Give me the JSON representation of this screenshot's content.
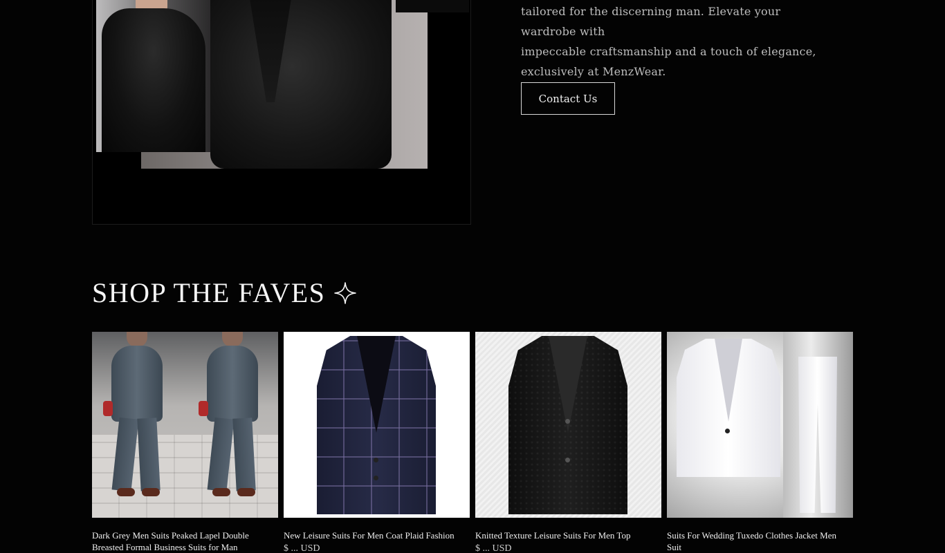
{
  "hero": {
    "paragraph_lines": [
      "tailored for the discerning man. Elevate your wardrobe with",
      "impeccable craftsmanship and a touch of elegance,",
      "exclusively at MenzWear."
    ],
    "contact_label": "Contact Us"
  },
  "section": {
    "title": "SHOP THE FAVES",
    "title_icon": "sparkle-icon"
  },
  "products": [
    {
      "title": "Dark Grey Men Suits Peaked Lapel Double Breasted Formal Business Suits for Man",
      "image": "grey-double-breasted-suit"
    },
    {
      "title": "New Leisure Suits For Men Coat Plaid Fashion",
      "price": "$ ... USD",
      "image": "navy-plaid-blazer"
    },
    {
      "title": "Knitted Texture Leisure Suits For Men Top",
      "price": "$ ... USD",
      "image": "black-knitted-blazer"
    },
    {
      "title": "Suits For Wedding Tuxedo Clothes Jacket Men Suit",
      "image": "white-tuxedo-suit"
    }
  ],
  "colors": {
    "background": "#030303",
    "text_muted": "#bdbdbd",
    "button_border": "#d9d9d9"
  }
}
